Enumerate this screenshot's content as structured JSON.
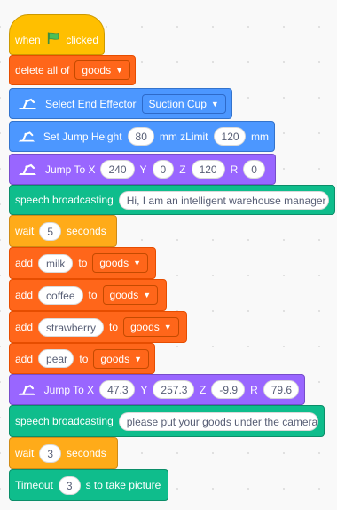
{
  "blocks": {
    "when_flag": {
      "when": "when",
      "clicked": "clicked"
    },
    "delete_all": {
      "label": "delete all of",
      "list": "goods"
    },
    "select_effector": {
      "label": "Select End Effector",
      "value": "Suction Cup"
    },
    "jump_height": {
      "label": "Set Jump Height",
      "height": "80",
      "zlimit_label": "mm zLimit",
      "zlimit": "120",
      "unit": "mm"
    },
    "jump_to_1": {
      "label": "Jump To X",
      "x": "240",
      "y_label": "Y",
      "y": "0",
      "z_label": "Z",
      "z": "120",
      "r_label": "R",
      "r": "0"
    },
    "speech_1": {
      "label": "speech broadcasting",
      "text": "Hi, I am an intelligent warehouse manager"
    },
    "wait_1": {
      "label": "wait",
      "value": "5",
      "unit": "seconds"
    },
    "add_items": [
      {
        "add": "add",
        "item": "milk",
        "to": "to",
        "list": "goods"
      },
      {
        "add": "add",
        "item": "coffee",
        "to": "to",
        "list": "goods"
      },
      {
        "add": "add",
        "item": "strawberry",
        "to": "to",
        "list": "goods"
      },
      {
        "add": "add",
        "item": "pear",
        "to": "to",
        "list": "goods"
      }
    ],
    "jump_to_2": {
      "label": "Jump To X",
      "x": "47.3",
      "y_label": "Y",
      "y": "257.3",
      "z_label": "Z",
      "z": "-9.9",
      "r_label": "R",
      "r": "79.6"
    },
    "speech_2": {
      "label": "speech broadcasting",
      "text": "please put your goods under the camera"
    },
    "wait_2": {
      "label": "wait",
      "value": "3",
      "unit": "seconds"
    },
    "timeout": {
      "label": "Timeout",
      "value": "3",
      "suffix": "s to take picture"
    }
  },
  "colors": {
    "events": "#ffbf00",
    "list": "#ff661a",
    "robot": "#4c97ff",
    "robot_motion": "#9966ff",
    "sound": "#0fbd8c",
    "control": "#ffab19",
    "flag": "#4cbf56"
  },
  "icons": {
    "flag": "green-flag-icon",
    "robot": "robot-arm-icon",
    "dropdown": "dropdown-caret-icon"
  }
}
